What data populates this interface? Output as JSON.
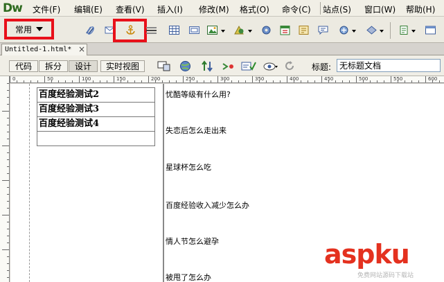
{
  "app": {
    "logo": "Dw"
  },
  "menu": [
    "文件(F)",
    "编辑(E)",
    "查看(V)",
    "插入(I)",
    "修改(M)",
    "格式(O)",
    "命令(C)",
    "站点(S)",
    "窗口(W)",
    "帮助(H)"
  ],
  "insert_toolbar": {
    "category": "常用",
    "icons": [
      "hyperlink-icon",
      "email-link-icon",
      "named-anchor-icon",
      "horizontal-rule-icon",
      "table-icon",
      "div-icon",
      "image-icon",
      "media-icon",
      "head-icon",
      "date-icon",
      "server-include-icon",
      "comment-icon",
      "template-icon",
      "tag-chooser-icon"
    ],
    "accent": "#e8101a"
  },
  "document_tab": {
    "label": "Untitled-1.html*",
    "close": "×"
  },
  "doc_toolbar": {
    "views": [
      "代码",
      "拆分",
      "设计",
      "实时视图"
    ],
    "title_label": "标题:",
    "title_value": "无标题文档"
  },
  "ruler": [
    "0",
    "50",
    "100",
    "150",
    "200",
    "250",
    "300",
    "350",
    "400",
    "450",
    "500",
    "550",
    "600"
  ],
  "table_rows": [
    "百度经验测试2",
    "百度经验测试3",
    "百度经验测试4",
    ""
  ],
  "questions": [
    "忧酷等级有什么用?",
    "失恋后怎么走出来",
    "星球杯怎么吃",
    "百度经验收入减少怎么办",
    "情人节怎么避孕",
    "被甩了怎么办"
  ],
  "watermark": {
    "text": "aspku",
    "sub": "免费网站源码下载站"
  }
}
